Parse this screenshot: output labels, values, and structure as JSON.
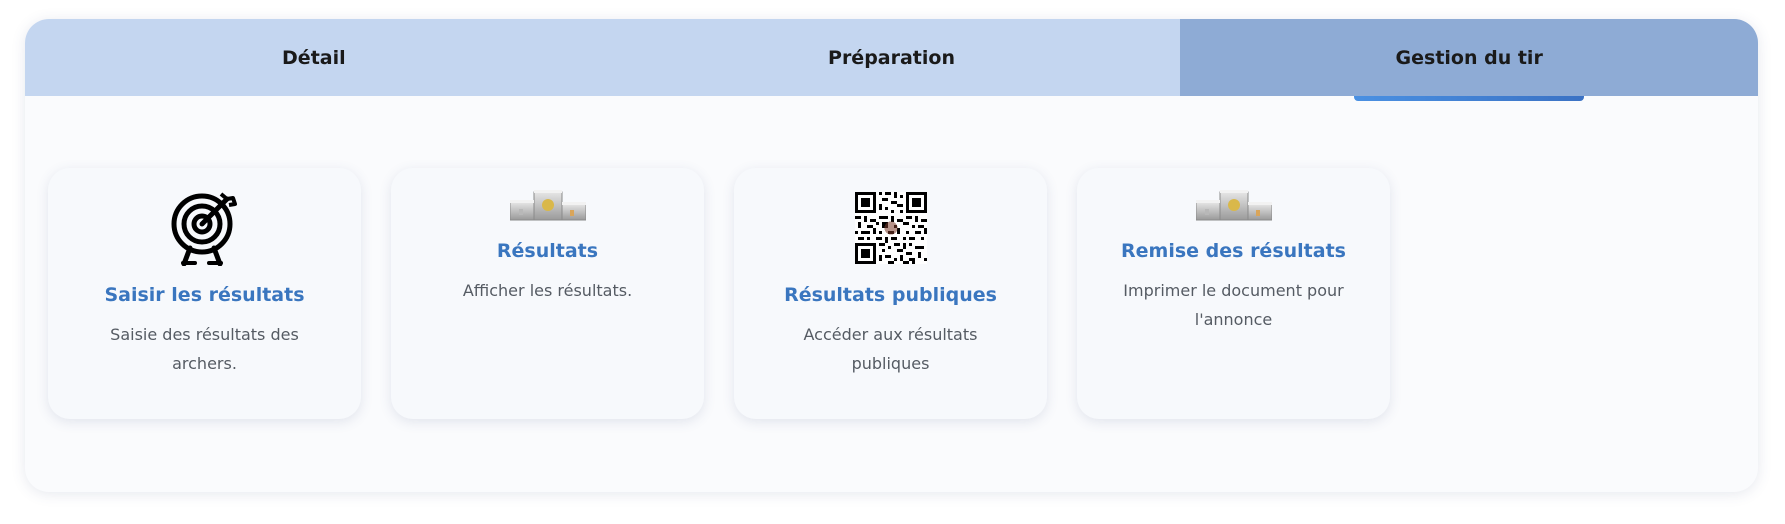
{
  "tabs": [
    {
      "label": "Détail",
      "active": false
    },
    {
      "label": "Préparation",
      "active": false
    },
    {
      "label": "Gestion du tir",
      "active": true
    }
  ],
  "cards": [
    {
      "icon": "target-icon",
      "title": "Saisir les résultats",
      "description": "Saisie des résultats des archers."
    },
    {
      "icon": "podium-icon",
      "title": "Résultats",
      "description": "Afficher les résultats."
    },
    {
      "icon": "qr-code-icon",
      "title": "Résultats publiques",
      "description": "Accéder aux résultats publiques"
    },
    {
      "icon": "podium-icon",
      "title": "Remise des résultats",
      "description": "Imprimer le document pour l'annonce"
    }
  ],
  "colors": {
    "tab_bg": "#c4d6f0",
    "tab_active_bg": "#8eabd5",
    "accent": "#3a76bf",
    "indicator": "#4a90e2"
  }
}
